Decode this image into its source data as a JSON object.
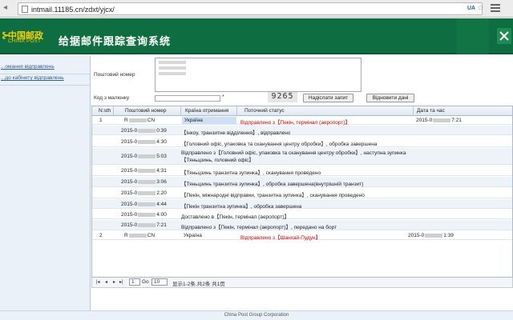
{
  "browser": {
    "url": "intmail.11185.cn/zdxt/yjcx/",
    "ua_badge": "UA",
    "star": "☆"
  },
  "header": {
    "logo_cn": "中国邮政",
    "logo_en": "CHINA POST",
    "title": "给据邮件跟踪查询系统"
  },
  "sidebar": {
    "items": [
      {
        "label": "...омання відправлень"
      },
      {
        "label": "...до кабінету відправлень"
      }
    ]
  },
  "form": {
    "tracking_label": "Поштовий номер",
    "captcha_label": "Код з малюнку",
    "captcha_required": "*",
    "captcha_code": "9265",
    "submit_label": "Надіслати запит",
    "reset_label": "Відновити дані"
  },
  "table": {
    "headers": [
      "N:sth",
      "Поштовий номер",
      "Країна отримання",
      "Поточний статус",
      "Дата та час"
    ],
    "rows": [
      {
        "num": "1",
        "tracking_prefix": "R",
        "tracking_suffix": "CN",
        "country": "Україна",
        "status": "Відправлено з【Пекін, термінал (аеропорт)】",
        "date_prefix": "2015-0",
        "date_suffix": "7:21"
      },
      {
        "num": "2",
        "tracking_prefix": "R",
        "tracking_suffix": "CN",
        "country": "Україна",
        "status": "Відправлено з【Шанхай-Пудун】",
        "date_prefix": "2015-0",
        "date_suffix": "1:39"
      }
    ],
    "details": [
      {
        "time_prefix": "2015-0",
        "time_suffix": "0:39",
        "text": "【Інкоу, транзитне відділення】, відправлено"
      },
      {
        "time_prefix": "2015-0",
        "time_suffix": "4:30",
        "text": "【Головний офіс, упаковка та сканування центру обробки】, обробка завершена"
      },
      {
        "time_prefix": "2015-0",
        "time_suffix": "5:03",
        "text": "Відправлено з【Головний офіс, упаковка та сканування центру обробки】, наступна зупинка【Тяньцзинь, головний офіс】"
      },
      {
        "time_prefix": "2015-0",
        "time_suffix": "4:31",
        "text": "【Тяньцзинь транзитна зупинка】, сканування проведено"
      },
      {
        "time_prefix": "2015-0",
        "time_suffix": "3:06",
        "text": "【Тяньцзинь транзитна зупинка】, обробка завершена(внутрішній транзит)"
      },
      {
        "time_prefix": "2015-0",
        "time_suffix": "2:20",
        "text": "【Пекін, міжнародні відправки, транзитна зупинка】, сканування проведено"
      },
      {
        "time_prefix": "2015-0",
        "time_suffix": "4:44",
        "text": "【Пекін транзитна зупинка】, обробка завершена"
      },
      {
        "time_prefix": "2015-0",
        "time_suffix": "4:00",
        "text": "Доставлено в【Пекін, термінал (аеропорт)】"
      },
      {
        "time_prefix": "2015-0",
        "time_suffix": "7:21",
        "text": "Відправлено з【Пекін, термінал (аеропорт)】, передано на борт"
      }
    ]
  },
  "pager": {
    "page": "1",
    "of": "Go",
    "page_size": "10",
    "summary": "显示1-2条,共2条  共1页"
  },
  "footer": {
    "text": "China Post Group Corporation"
  }
}
